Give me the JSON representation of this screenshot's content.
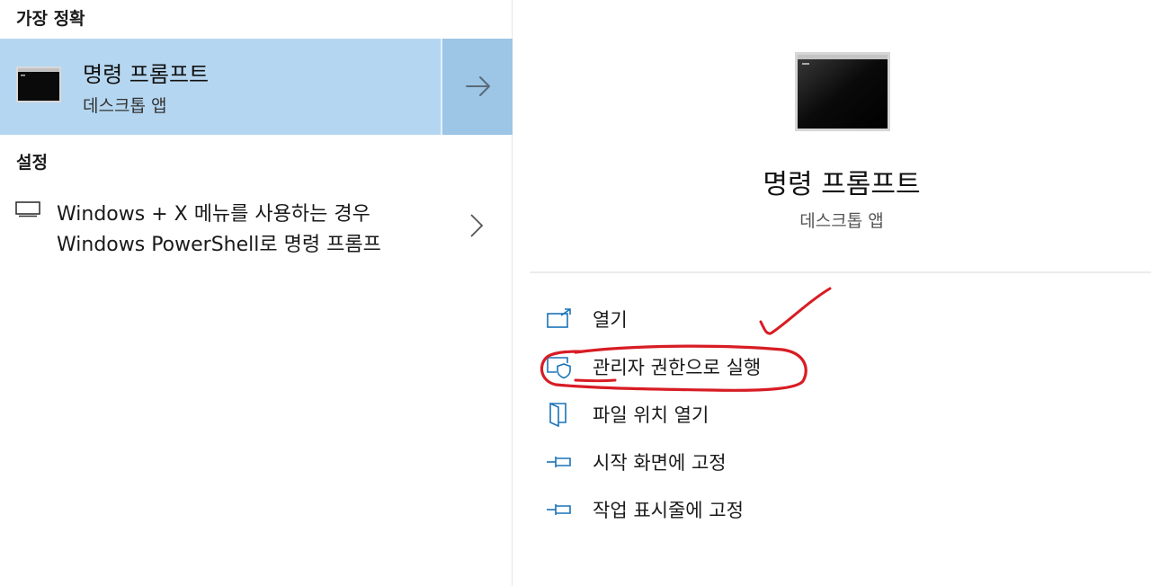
{
  "sections": {
    "best_match": "가장 정확",
    "settings": "설정"
  },
  "best_match_item": {
    "title": "명령 프롬프트",
    "subtitle": "데스크톱 앱",
    "icon": "terminal-icon",
    "arrow_icon": "arrow-right-icon"
  },
  "settings_item": {
    "icon": "monitor-icon",
    "line1": "Windows + X 메뉴를 사용하는 경우",
    "line2": "Windows PowerShell로 명령 프롬프",
    "chevron_icon": "chevron-right-icon"
  },
  "preview": {
    "title": "명령 프롬프트",
    "subtitle": "데스크톱 앱",
    "icon": "terminal-icon"
  },
  "actions": [
    {
      "label": "열기",
      "icon": "open-icon"
    },
    {
      "label": "관리자 권한으로 실행",
      "icon": "shield-icon"
    },
    {
      "label": "파일 위치 열기",
      "icon": "folder-location-icon"
    },
    {
      "label": "시작 화면에 고정",
      "icon": "pin-icon"
    },
    {
      "label": "작업 표시줄에 고정",
      "icon": "pin-icon"
    }
  ],
  "colors": {
    "selected_bg": "#b5d6f0",
    "selected_arrow_bg": "#9cc5e6",
    "icon_accent": "#1a73b8",
    "annotation": "#d81c24"
  }
}
